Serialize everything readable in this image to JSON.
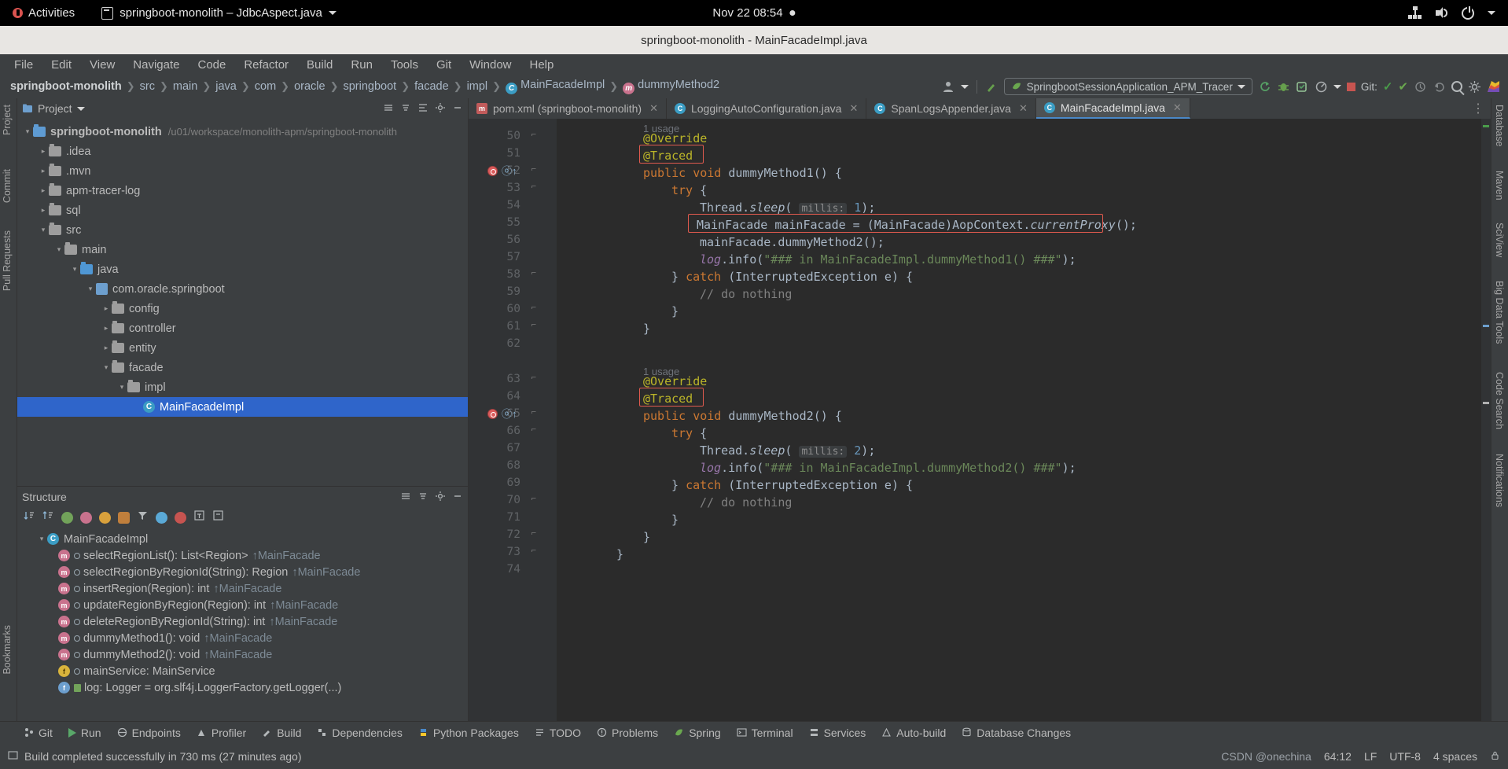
{
  "os_bar": {
    "activities": "Activities",
    "window_title": "springboot-monolith – JdbcAspect.java",
    "clock": "Nov 22  08:54",
    "icons": [
      "network-icon",
      "volume-icon",
      "power-icon",
      "chevron-down-icon"
    ]
  },
  "window": {
    "title": "springboot-monolith - MainFacadeImpl.java"
  },
  "menu": [
    "File",
    "Edit",
    "View",
    "Navigate",
    "Code",
    "Refactor",
    "Build",
    "Run",
    "Tools",
    "Git",
    "Window",
    "Help"
  ],
  "navbar": {
    "crumbs": [
      {
        "label": "springboot-monolith",
        "bold": true,
        "icon": ""
      },
      {
        "label": "src",
        "bold": false,
        "icon": ""
      },
      {
        "label": "main",
        "bold": false,
        "icon": ""
      },
      {
        "label": "java",
        "bold": false,
        "icon": ""
      },
      {
        "label": "com",
        "bold": false,
        "icon": ""
      },
      {
        "label": "oracle",
        "bold": false,
        "icon": ""
      },
      {
        "label": "springboot",
        "bold": false,
        "icon": ""
      },
      {
        "label": "facade",
        "bold": false,
        "icon": ""
      },
      {
        "label": "impl",
        "bold": false,
        "icon": ""
      },
      {
        "label": "MainFacadeImpl",
        "bold": false,
        "icon": "class"
      },
      {
        "label": "dummyMethod2",
        "bold": false,
        "icon": "method"
      }
    ],
    "run_config": "SpringbootSessionApplication_APM_Tracer",
    "git_label": "Git:",
    "search_icon": "search-icon",
    "settings_icon": "gear-icon"
  },
  "project_panel": {
    "title": "Project",
    "tree": [
      {
        "indent": 0,
        "arrow": "▾",
        "icon": "folder-blue",
        "label": "springboot-monolith",
        "path": "/u01/workspace/monolith-apm/springboot-monolith",
        "selected": false,
        "bold": true
      },
      {
        "indent": 1,
        "arrow": "▸",
        "icon": "folder",
        "label": ".idea",
        "path": "",
        "selected": false,
        "bold": false
      },
      {
        "indent": 1,
        "arrow": "▸",
        "icon": "folder",
        "label": ".mvn",
        "path": "",
        "selected": false,
        "bold": false
      },
      {
        "indent": 1,
        "arrow": "▸",
        "icon": "folder",
        "label": "apm-tracer-log",
        "path": "",
        "selected": false,
        "bold": false
      },
      {
        "indent": 1,
        "arrow": "▸",
        "icon": "folder",
        "label": "sql",
        "path": "",
        "selected": false,
        "bold": false
      },
      {
        "indent": 1,
        "arrow": "▾",
        "icon": "folder",
        "label": "src",
        "path": "",
        "selected": false,
        "bold": false
      },
      {
        "indent": 2,
        "arrow": "▾",
        "icon": "folder",
        "label": "main",
        "path": "",
        "selected": false,
        "bold": false
      },
      {
        "indent": 3,
        "arrow": "▾",
        "icon": "folder-src",
        "label": "java",
        "path": "",
        "selected": false,
        "bold": false
      },
      {
        "indent": 4,
        "arrow": "▾",
        "icon": "package",
        "label": "com.oracle.springboot",
        "path": "",
        "selected": false,
        "bold": false
      },
      {
        "indent": 5,
        "arrow": "▸",
        "icon": "folder",
        "label": "config",
        "path": "",
        "selected": false,
        "bold": false
      },
      {
        "indent": 5,
        "arrow": "▸",
        "icon": "folder",
        "label": "controller",
        "path": "",
        "selected": false,
        "bold": false
      },
      {
        "indent": 5,
        "arrow": "▸",
        "icon": "folder",
        "label": "entity",
        "path": "",
        "selected": false,
        "bold": false
      },
      {
        "indent": 5,
        "arrow": "▾",
        "icon": "folder",
        "label": "facade",
        "path": "",
        "selected": false,
        "bold": false
      },
      {
        "indent": 6,
        "arrow": "▾",
        "icon": "folder",
        "label": "impl",
        "path": "",
        "selected": false,
        "bold": false
      },
      {
        "indent": 7,
        "arrow": "",
        "icon": "class",
        "label": "MainFacadeImpl",
        "path": "",
        "selected": true,
        "bold": false
      }
    ]
  },
  "structure_panel": {
    "title": "Structure",
    "items": [
      {
        "indent": 0,
        "arrow": "▾",
        "icon": "class",
        "vis": "",
        "label": "MainFacadeImpl",
        "over": ""
      },
      {
        "indent": 1,
        "arrow": "",
        "icon": "method",
        "vis": "pub",
        "label": "selectRegionList(): List<Region>",
        "over": "↑MainFacade"
      },
      {
        "indent": 1,
        "arrow": "",
        "icon": "method",
        "vis": "pub",
        "label": "selectRegionByRegionId(String): Region",
        "over": "↑MainFacade"
      },
      {
        "indent": 1,
        "arrow": "",
        "icon": "method",
        "vis": "pub",
        "label": "insertRegion(Region): int",
        "over": "↑MainFacade"
      },
      {
        "indent": 1,
        "arrow": "",
        "icon": "method",
        "vis": "pub",
        "label": "updateRegionByRegion(Region): int",
        "over": "↑MainFacade"
      },
      {
        "indent": 1,
        "arrow": "",
        "icon": "method",
        "vis": "pub",
        "label": "deleteRegionByRegionId(String): int",
        "over": "↑MainFacade"
      },
      {
        "indent": 1,
        "arrow": "",
        "icon": "method",
        "vis": "pub",
        "label": "dummyMethod1(): void",
        "over": "↑MainFacade"
      },
      {
        "indent": 1,
        "arrow": "",
        "icon": "method",
        "vis": "pub",
        "label": "dummyMethod2(): void",
        "over": "↑MainFacade"
      },
      {
        "indent": 1,
        "arrow": "",
        "icon": "field",
        "vis": "prot",
        "label": "mainService: MainService",
        "over": ""
      },
      {
        "indent": 1,
        "arrow": "",
        "icon": "field2",
        "vis": "priv",
        "label": "log: Logger = org.slf4j.LoggerFactory.getLogger(...)",
        "over": ""
      }
    ]
  },
  "editor_tabs": [
    {
      "label": "pom.xml (springboot-monolith)",
      "icon": "maven-icon",
      "active": false,
      "closable": true
    },
    {
      "label": "LoggingAutoConfiguration.java",
      "icon": "class-icon",
      "active": false,
      "closable": true
    },
    {
      "label": "SpanLogsAppender.java",
      "icon": "class-icon",
      "active": false,
      "closable": true
    },
    {
      "label": "MainFacadeImpl.java",
      "icon": "class-icon",
      "active": true,
      "closable": true
    }
  ],
  "editor": {
    "first_line": 50,
    "usage_hints": [
      {
        "line": 49,
        "text": "1 usage"
      },
      {
        "line": 62,
        "text": "1 usage"
      }
    ],
    "lines": [
      {
        "n": 50,
        "segments": [
          {
            "t": "@Override",
            "c": "ann"
          }
        ],
        "indent": 1
      },
      {
        "n": 51,
        "segments": [
          {
            "t": "@Traced",
            "c": "ann"
          }
        ],
        "indent": 1,
        "highlight": true
      },
      {
        "n": 52,
        "segments": [
          {
            "t": "public",
            "c": "kw"
          },
          {
            "t": " ",
            "c": ""
          },
          {
            "t": "void",
            "c": "kw"
          },
          {
            "t": " dummyMethod1() {",
            "c": ""
          }
        ],
        "indent": 1,
        "breakpoint": true,
        "override": true
      },
      {
        "n": 53,
        "segments": [
          {
            "t": "try",
            "c": "kw"
          },
          {
            "t": " {",
            "c": ""
          }
        ],
        "indent": 2
      },
      {
        "n": 54,
        "segments": [
          {
            "t": "Thread.",
            "c": ""
          },
          {
            "t": "sleep",
            "c": "ital"
          },
          {
            "t": "( ",
            "c": ""
          },
          {
            "t": "millis:",
            "c": "hint"
          },
          {
            "t": " ",
            "c": ""
          },
          {
            "t": "1",
            "c": "num"
          },
          {
            "t": ");",
            "c": ""
          }
        ],
        "indent": 3
      },
      {
        "n": 55,
        "segments": [
          {
            "t": "MainFacade mainFacade = (MainFacade)AopContext.",
            "c": ""
          },
          {
            "t": "currentProxy",
            "c": "ital"
          },
          {
            "t": "();",
            "c": ""
          }
        ],
        "indent": 3,
        "highlight": true
      },
      {
        "n": 56,
        "segments": [
          {
            "t": "mainFacade.dummyMethod2();",
            "c": ""
          }
        ],
        "indent": 3
      },
      {
        "n": 57,
        "segments": [
          {
            "t": "log",
            "c": "fld"
          },
          {
            "t": ".info(",
            "c": ""
          },
          {
            "t": "\"### in MainFacadeImpl.dummyMethod1() ###\"",
            "c": "str"
          },
          {
            "t": ");",
            "c": ""
          }
        ],
        "indent": 3
      },
      {
        "n": 58,
        "segments": [
          {
            "t": "} ",
            "c": ""
          },
          {
            "t": "catch",
            "c": "kw"
          },
          {
            "t": " (InterruptedException e) {",
            "c": ""
          }
        ],
        "indent": 2
      },
      {
        "n": 59,
        "segments": [
          {
            "t": "// do nothing",
            "c": "cmt"
          }
        ],
        "indent": 3
      },
      {
        "n": 60,
        "segments": [
          {
            "t": "}",
            "c": ""
          },
          {
            "t": "",
            "c": ""
          }
        ],
        "indent": 2
      },
      {
        "n": 61,
        "segments": [
          {
            "t": "}",
            "c": ""
          }
        ],
        "indent": 1
      },
      {
        "n": 62,
        "segments": [],
        "indent": 0
      },
      {
        "n": 63,
        "segments": [
          {
            "t": "@Override",
            "c": "ann"
          }
        ],
        "indent": 1
      },
      {
        "n": 64,
        "segments": [
          {
            "t": "@Traced",
            "c": "ann"
          }
        ],
        "indent": 1,
        "highlight": true
      },
      {
        "n": 65,
        "segments": [
          {
            "t": "public",
            "c": "kw"
          },
          {
            "t": " ",
            "c": ""
          },
          {
            "t": "void",
            "c": "kw"
          },
          {
            "t": " dummyMethod2() {",
            "c": ""
          }
        ],
        "indent": 1,
        "breakpoint": true,
        "override": true
      },
      {
        "n": 66,
        "segments": [
          {
            "t": "try",
            "c": "kw"
          },
          {
            "t": " {",
            "c": ""
          }
        ],
        "indent": 2
      },
      {
        "n": 67,
        "segments": [
          {
            "t": "Thread.",
            "c": ""
          },
          {
            "t": "sleep",
            "c": "ital"
          },
          {
            "t": "( ",
            "c": ""
          },
          {
            "t": "millis:",
            "c": "hint"
          },
          {
            "t": " ",
            "c": ""
          },
          {
            "t": "2",
            "c": "num"
          },
          {
            "t": ");",
            "c": ""
          }
        ],
        "indent": 3
      },
      {
        "n": 68,
        "segments": [
          {
            "t": "log",
            "c": "fld"
          },
          {
            "t": ".info(",
            "c": ""
          },
          {
            "t": "\"### in MainFacadeImpl.dummyMethod2() ###\"",
            "c": "str"
          },
          {
            "t": ");",
            "c": ""
          }
        ],
        "indent": 3
      },
      {
        "n": 69,
        "segments": [
          {
            "t": "} ",
            "c": ""
          },
          {
            "t": "catch",
            "c": "kw"
          },
          {
            "t": " (InterruptedException e) {",
            "c": ""
          }
        ],
        "indent": 2
      },
      {
        "n": 70,
        "segments": [
          {
            "t": "// do nothing",
            "c": "cmt"
          }
        ],
        "indent": 3
      },
      {
        "n": 71,
        "segments": [
          {
            "t": "}",
            "c": ""
          }
        ],
        "indent": 2
      },
      {
        "n": 72,
        "segments": [
          {
            "t": "}",
            "c": ""
          }
        ],
        "indent": 1
      },
      {
        "n": 73,
        "segments": [
          {
            "t": "}",
            "c": ""
          }
        ],
        "indent": 0
      },
      {
        "n": 74,
        "segments": [],
        "indent": 0
      }
    ]
  },
  "left_strip": [
    "Project",
    "Commit",
    "Pull Requests"
  ],
  "right_strip": [
    "Database",
    "Maven",
    "SciView",
    "Big Data Tools",
    "Code Search",
    "Notifications"
  ],
  "bottom_left_strip": [
    "Bookmarks",
    "Structure"
  ],
  "bottom_tools": [
    {
      "label": "Git",
      "icon": "git-icon"
    },
    {
      "label": "Run",
      "icon": "run-icon"
    },
    {
      "label": "Endpoints",
      "icon": "endpoints-icon"
    },
    {
      "label": "Profiler",
      "icon": "profiler-icon"
    },
    {
      "label": "Build",
      "icon": "build-icon"
    },
    {
      "label": "Dependencies",
      "icon": "dependencies-icon"
    },
    {
      "label": "Python Packages",
      "icon": "python-icon"
    },
    {
      "label": "TODO",
      "icon": "todo-icon"
    },
    {
      "label": "Problems",
      "icon": "problems-icon"
    },
    {
      "label": "Spring",
      "icon": "spring-icon"
    },
    {
      "label": "Terminal",
      "icon": "terminal-icon"
    },
    {
      "label": "Services",
      "icon": "services-icon"
    },
    {
      "label": "Auto-build",
      "icon": "autobuild-icon"
    },
    {
      "label": "Database Changes",
      "icon": "database-icon"
    }
  ],
  "status_bar": {
    "message": "Build completed successfully in 730 ms (27 minutes ago)",
    "caret": "64:12",
    "line_sep": "LF",
    "encoding": "UTF-8",
    "indent": "4 spaces",
    "watermark": "CSDN @onechina"
  },
  "colors": {
    "accent_blue": "#2f65ca",
    "highlight_red": "#e05a4e",
    "annotation": "#bbb529",
    "keyword": "#cc7832",
    "string": "#6a8759",
    "editor_bg": "#2b2b2b",
    "panel_bg": "#3c3f41"
  }
}
